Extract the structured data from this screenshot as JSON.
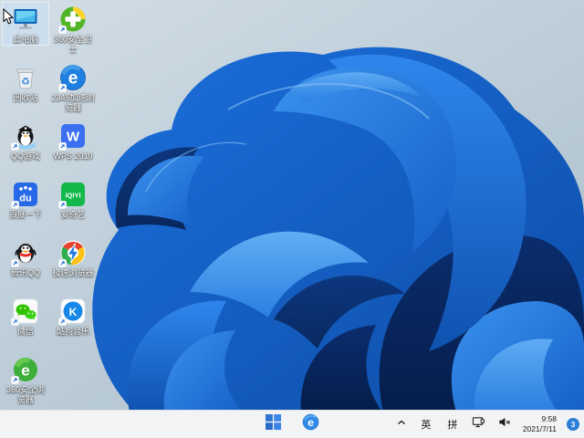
{
  "desktop": {
    "icons": [
      {
        "name": "this-pc",
        "label": "此电脑",
        "shortcut": false,
        "selected": true
      },
      {
        "name": "360-safe-guard",
        "label": "360安全卫士",
        "shortcut": true,
        "selected": false
      },
      {
        "name": "recycle-bin",
        "label": "回收站",
        "shortcut": false,
        "selected": false
      },
      {
        "name": "2345-browser",
        "label": "2345加速浏览器",
        "shortcut": true,
        "selected": false
      },
      {
        "name": "qq-games",
        "label": "QQ游戏",
        "shortcut": true,
        "selected": false
      },
      {
        "name": "wps-2019",
        "label": "WPS 2019",
        "shortcut": true,
        "selected": false
      },
      {
        "name": "baidu-search",
        "label": "百度一下",
        "shortcut": true,
        "selected": false
      },
      {
        "name": "iqiyi",
        "label": "爱奇艺",
        "shortcut": true,
        "selected": false
      },
      {
        "name": "tencent-qq",
        "label": "腾讯QQ",
        "shortcut": true,
        "selected": false
      },
      {
        "name": "speed-browser",
        "label": "极速浏览器",
        "shortcut": true,
        "selected": false
      },
      {
        "name": "wechat",
        "label": "微信",
        "shortcut": true,
        "selected": false
      },
      {
        "name": "kugou-music",
        "label": "酷狗音乐",
        "shortcut": true,
        "selected": false
      },
      {
        "name": "360-safe-browser",
        "label": "360安全浏览器",
        "shortcut": true,
        "selected": false
      }
    ]
  },
  "taskbar": {
    "buttons": [
      {
        "name": "start",
        "icon": "windows-logo-icon"
      },
      {
        "name": "pinned-browser",
        "icon": "browser-e-icon"
      }
    ],
    "tray": {
      "ime_english": "英",
      "ime_pinyin": "拼",
      "clock": {
        "time": "9:58",
        "date": "2021/7/11"
      },
      "notification_count": "3"
    }
  },
  "colors": {
    "taskbar_bg": "#f2f3f5",
    "accent_blue": "#2b7fd4",
    "wallpaper_top": "#d3dee6",
    "wallpaper_bottom": "#a8bccb",
    "bloom_mid_blue": "#1c6fdd",
    "bloom_dark_blue": "#0a2d6e",
    "bloom_light_blue": "#62aef5"
  }
}
